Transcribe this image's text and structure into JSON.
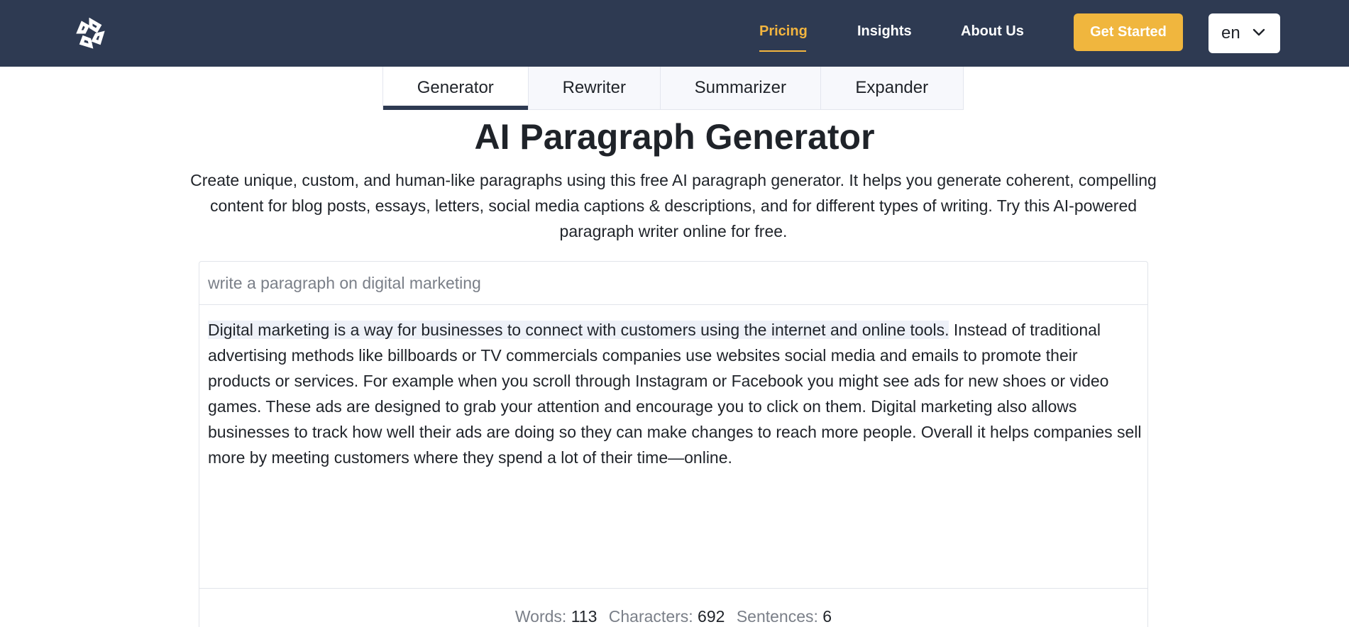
{
  "nav": {
    "logo_icon": "brand-logo-icon",
    "links": [
      "Pricing",
      "Insights",
      "About Us"
    ],
    "active_link": "Pricing",
    "cta_label": "Get Started",
    "language": "en",
    "colors": {
      "bar": "#2e3a52",
      "accent": "#f0b63e"
    }
  },
  "tabs": [
    {
      "label": "Generator",
      "active": true
    },
    {
      "label": "Rewriter",
      "active": false
    },
    {
      "label": "Summarizer",
      "active": false
    },
    {
      "label": "Expander",
      "active": false
    }
  ],
  "page": {
    "title": "AI Paragraph Generator",
    "description": "Create unique, custom, and human-like paragraphs using this free AI paragraph generator. It helps you generate coherent, compelling content for blog posts, essays, letters, social media captions & descriptions, and for different types of writing. Try this AI-powered paragraph writer online for free."
  },
  "editor": {
    "prompt_value": "",
    "prompt_placeholder": "write a paragraph on digital marketing",
    "output_highlighted": "Digital marketing is a way for businesses to connect with customers using the internet and online tools.",
    "output_rest": " Instead of traditional advertising methods like billboards or TV commercials companies use websites social media and emails to promote their products or services. For example when you scroll through Instagram or Facebook you might see ads for new shoes or video games. These ads are designed to grab your attention and encourage you to click on them. Digital marketing also allows businesses to track how well their ads are doing so they can make changes to reach more people. Overall it helps companies sell more by meeting customers where they spend a lot of their time—online."
  },
  "stats": {
    "words_label": "Words:",
    "words": "113",
    "characters_label": "Characters:",
    "characters": "692",
    "sentences_label": "Sentences:",
    "sentences": "6"
  }
}
